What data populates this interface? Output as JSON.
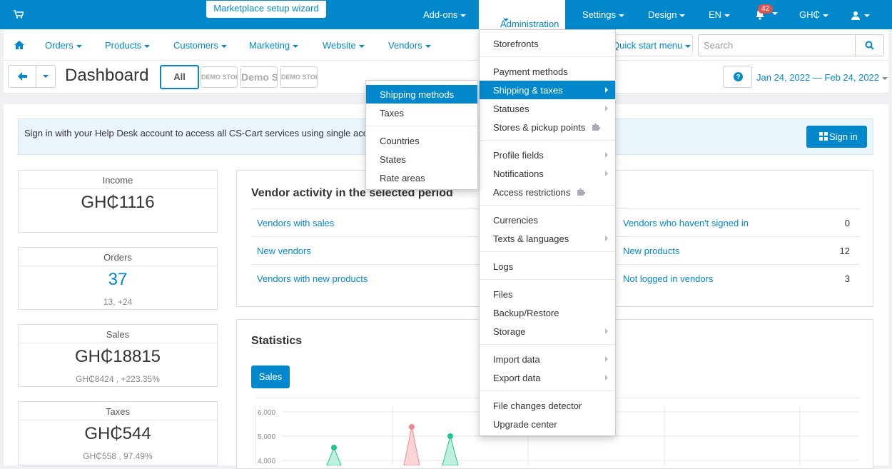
{
  "topbar": {
    "wizard_label": "Marketplace setup wizard",
    "addons": "Add-ons",
    "administration": "Administration",
    "settings": "Settings",
    "design": "Design",
    "language": "EN",
    "notifications_count": "42",
    "currency": "GH₵"
  },
  "subnav": {
    "orders": "Orders",
    "products": "Products",
    "customers": "Customers",
    "marketing": "Marketing",
    "website": "Website",
    "vendors": "Vendors",
    "quick_start": "Quick start menu",
    "search_placeholder": "Search"
  },
  "header": {
    "title": "Dashboard",
    "all_label": "All",
    "store1": "DEMO STORE",
    "store2": "Demo Store",
    "store3": "DEMO STORE",
    "date_range": "Jan 24, 2022 — Feb 24, 2022"
  },
  "helpdesk": {
    "text": "Sign in with your Help Desk account to access all CS-Cart services using single account",
    "signin": "Sign in"
  },
  "stats": {
    "income_label": "Income",
    "income_value": "GH₵1116",
    "orders_label": "Orders",
    "orders_value": "37",
    "orders_sub": "13, +24",
    "sales_label": "Sales",
    "sales_value": "GH₵18815",
    "sales_sub": "GH₵8424 , +223.35%",
    "taxes_label": "Taxes",
    "taxes_value": "GH₵544",
    "taxes_sub": "GH₵558 , 97.49%"
  },
  "vendor_activity": {
    "title": "Vendor activity in the selected period",
    "rows": [
      {
        "left": "Vendors with sales",
        "right": "Vendors who haven't signed in",
        "num": "0"
      },
      {
        "left": "New vendors",
        "right": "New products",
        "num": "12"
      },
      {
        "left": "Vendors with new products",
        "right": "Not logged in vendors",
        "num": "3"
      }
    ]
  },
  "statistics": {
    "title": "Statistics",
    "tab": "Sales"
  },
  "chart_data": {
    "type": "area",
    "y_ticks": [
      "6,000",
      "5,000",
      "4,000"
    ]
  },
  "admin_menu": {
    "storefronts": "Storefronts",
    "payment_methods": "Payment methods",
    "shipping_taxes": "Shipping & taxes",
    "statuses": "Statuses",
    "stores_pickup": "Stores & pickup points",
    "profile_fields": "Profile fields",
    "notifications": "Notifications",
    "access_restrictions": "Access restrictions",
    "currencies": "Currencies",
    "texts_languages": "Texts & languages",
    "logs": "Logs",
    "files": "Files",
    "backup_restore": "Backup/Restore",
    "storage": "Storage",
    "import_data": "Import data",
    "export_data": "Export data",
    "file_changes": "File changes detector",
    "upgrade_center": "Upgrade center"
  },
  "shipping_menu": {
    "shipping_methods": "Shipping methods",
    "taxes": "Taxes",
    "countries": "Countries",
    "states": "States",
    "rate_areas": "Rate areas"
  },
  "colors": {
    "primary": "#0388cc",
    "green": "#1fc58e",
    "red": "#f08a8a"
  }
}
